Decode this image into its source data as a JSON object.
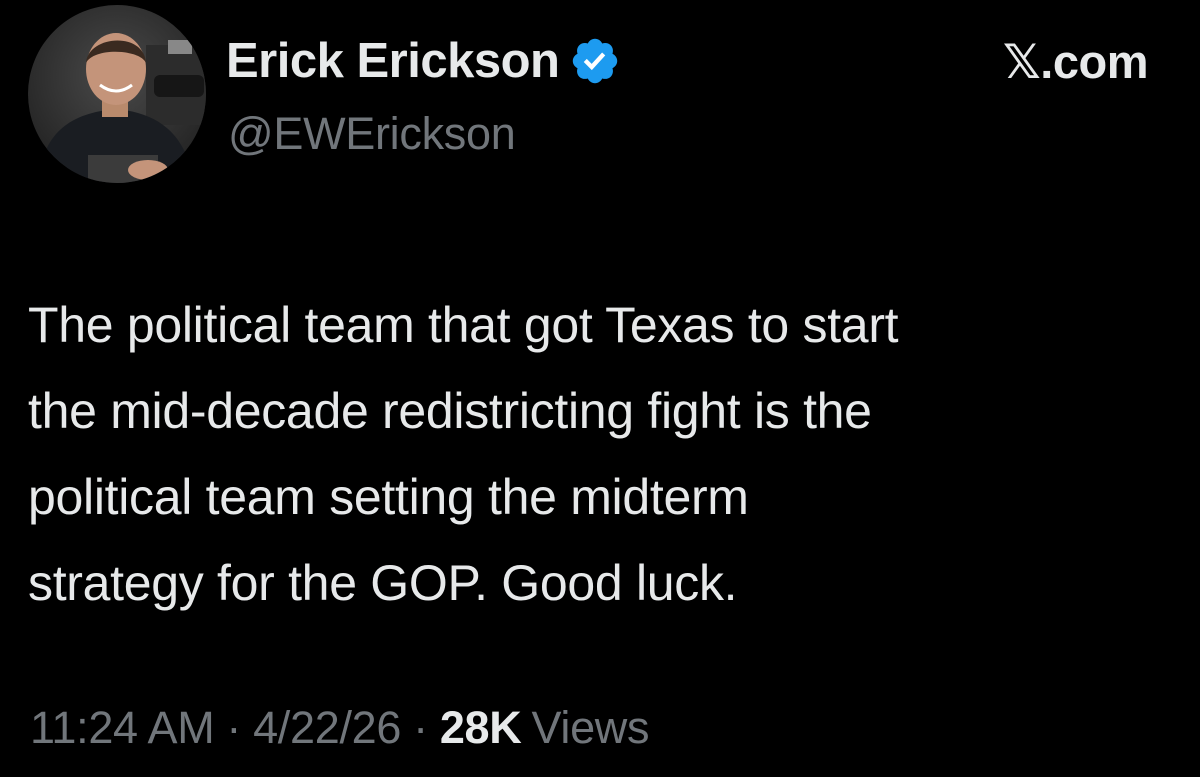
{
  "author": {
    "display_name": "Erick Erickson",
    "handle": "@EWErickson",
    "verified": true,
    "avatar_icon": "avatar-photo-icon"
  },
  "brand": {
    "label": "𝕏.com"
  },
  "tweet": {
    "text": "The political team that got Texas to start\nthe mid-decade redistricting fight is the\npolitical team setting the midterm\nstrategy for the GOP.  Good luck."
  },
  "meta": {
    "time": "11:24 AM",
    "separator": "·",
    "date": "4/22/26",
    "views_count": "28K",
    "views_label": "Views"
  },
  "colors": {
    "background": "#000000",
    "primary_text": "#e7e9ea",
    "secondary_text": "#71767b",
    "verified_badge": "#1d9bf0"
  }
}
